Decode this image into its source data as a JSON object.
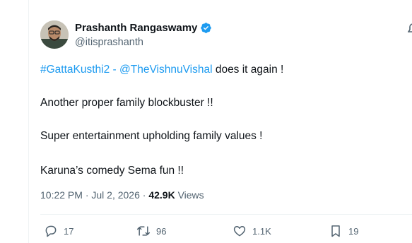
{
  "author": {
    "display_name": "Prashanth Rangaswamy",
    "handle": "@itisprashanth"
  },
  "tweet": {
    "hashtag": "#GattaKusthi2",
    "separator": " - ",
    "mention": "@TheVishnuVishal",
    "line1_rest": " does it again !",
    "line2": "Another proper family blockbuster !!",
    "line3": "Super entertainment upholding family values !",
    "line4": "Karuna’s comedy Sema fun !!"
  },
  "meta": {
    "timestamp": "10:22 PM · Jul 2, 2026",
    "dot": " · ",
    "views_count": "42.9K",
    "views_label": " Views"
  },
  "actions": {
    "reply_count": "17",
    "retweet_count": "96",
    "like_count": "1.1K",
    "bookmark_count": "19"
  },
  "colors": {
    "link": "#1d9bf0",
    "secondary_text": "#536471",
    "primary_text": "#0f1419",
    "verified_badge": "#1d9bf0"
  }
}
